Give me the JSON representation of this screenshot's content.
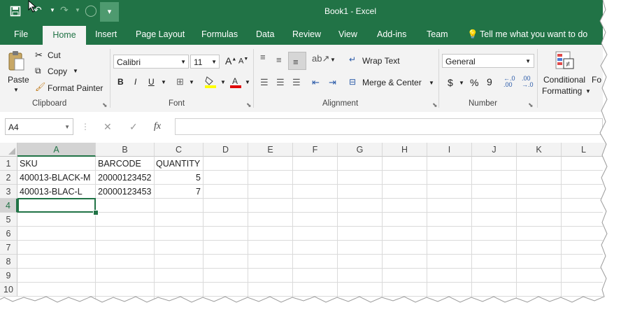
{
  "window": {
    "title": "Book1  -  Excel"
  },
  "tabs": [
    "File",
    "Home",
    "Insert",
    "Page Layout",
    "Formulas",
    "Data",
    "Review",
    "View",
    "Add-ins",
    "Team"
  ],
  "tell_me": "Tell me what you want to do",
  "clipboard": {
    "paste": "Paste",
    "cut": "Cut",
    "copy": "Copy",
    "format_painter": "Format Painter",
    "label": "Clipboard"
  },
  "font": {
    "name": "Calibri",
    "size": "11",
    "label": "Font",
    "bold": "B",
    "italic": "I",
    "underline": "U"
  },
  "alignment": {
    "wrap": "Wrap Text",
    "merge": "Merge & Center",
    "label": "Alignment"
  },
  "number": {
    "format": "General",
    "currency": "$",
    "percent": "%",
    "comma": "9",
    "label": "Number"
  },
  "styles": {
    "conditional": "Conditional",
    "formatting": "Formatting",
    "partial": "Fo"
  },
  "formula_bar": {
    "name_box": "A4",
    "fx": "fx",
    "value": ""
  },
  "columns": [
    "A",
    "B",
    "C",
    "D",
    "E",
    "F",
    "G",
    "H",
    "I",
    "J",
    "K",
    "L"
  ],
  "rows": [
    "1",
    "2",
    "3",
    "4",
    "5",
    "6",
    "7",
    "8",
    "9",
    "10"
  ],
  "cells": {
    "a1": "SKU",
    "b1": "BARCODE",
    "c1": "QUANTITY",
    "a2": "400013-BLACK-M",
    "b2": "20000123452",
    "c2": "5",
    "a3": "400013-BLAC-L",
    "b3": "20000123453",
    "c3": "7"
  },
  "selected_cell": "A4",
  "colors": {
    "excel_green": "#217346",
    "ribbon_bg": "#f3f3f3",
    "selection": "#217346"
  }
}
